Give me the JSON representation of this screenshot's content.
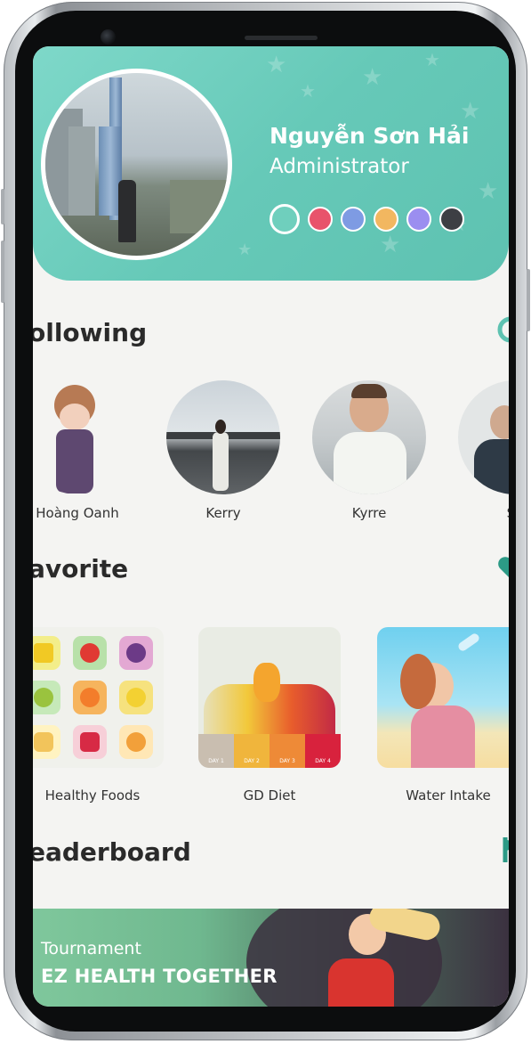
{
  "profile": {
    "name": "Nguyễn Sơn Hải",
    "role": "Administrator",
    "theme_colors": [
      "#6fcfbd",
      "#e8536b",
      "#7e9be3",
      "#f2b760",
      "#9b8ef0",
      "#3d3f44"
    ]
  },
  "following": {
    "title": "ollowing",
    "people": [
      {
        "name": "Hoàng Oanh",
        "icon": "avatar"
      },
      {
        "name": "Kerry",
        "icon": "avatar"
      },
      {
        "name": "Kyrre",
        "icon": "avatar"
      },
      {
        "name": "Sa",
        "icon": "avatar"
      }
    ]
  },
  "favorite": {
    "title": "avorite",
    "items": [
      {
        "label": "Healthy Foods"
      },
      {
        "label": "GD Diet",
        "days": [
          "DAY 1",
          "DAY 2",
          "DAY 3",
          "DAY 4"
        ]
      },
      {
        "label": "Water Intake"
      }
    ]
  },
  "leaderboard": {
    "title": "eaderboard",
    "banner_subtitle": "Tournament",
    "banner_title": "EZ HEALTH TOGETHER"
  },
  "colors": {
    "accent": "#5ec2b1",
    "heading": "#2a2a2a"
  }
}
